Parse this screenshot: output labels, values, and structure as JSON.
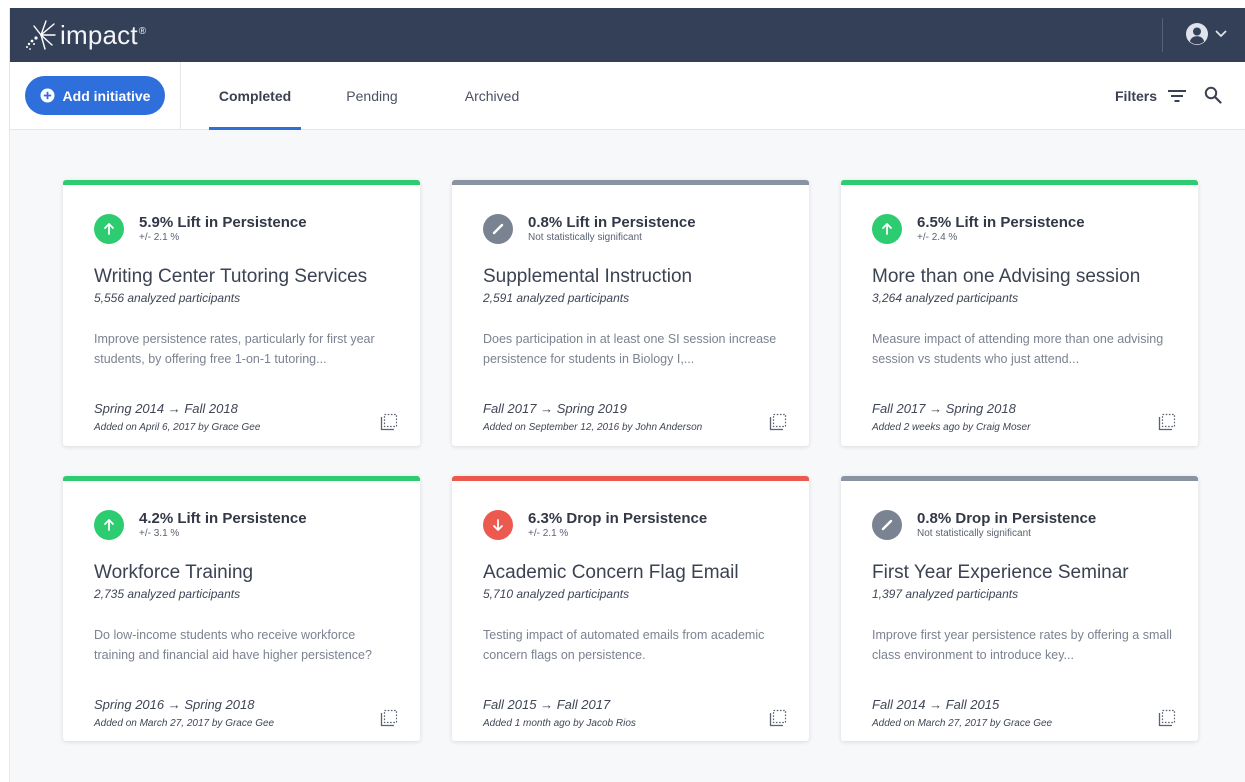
{
  "app": {
    "name": "impact",
    "trademark": "®"
  },
  "colors": {
    "navbar": "#343f58",
    "primary": "#2e6fdb",
    "positive": "#2ecc71",
    "negative": "#ec5a4f",
    "neutral": "#8a93a2"
  },
  "toolbar": {
    "add_label": "Add initiative",
    "tabs": [
      {
        "label": "Completed",
        "active": true
      },
      {
        "label": "Pending",
        "active": false
      },
      {
        "label": "Archived",
        "active": false
      }
    ],
    "filters_label": "Filters"
  },
  "cards": [
    {
      "status": "up",
      "metric": "5.9% Lift in Persistence",
      "metric_sub": "+/- 2.1 %",
      "title": "Writing Center Tutoring Services",
      "participants": "5,556 analyzed participants",
      "description": "Improve persistence rates, particularly for first year students, by offering free 1-on-1 tutoring...",
      "dates": "Spring 2014 → Fall 2018",
      "added": "Added on April 6, 2017 by Grace Gee"
    },
    {
      "status": "ns",
      "metric": "0.8% Lift in Persistence",
      "metric_sub": "Not statistically significant",
      "title": "Supplemental Instruction",
      "participants": "2,591 analyzed participants",
      "description": "Does participation in at least one SI session increase persistence for students in Biology I,...",
      "dates": "Fall 2017 → Spring 2019",
      "added": "Added on September 12,  2016 by John Anderson"
    },
    {
      "status": "up",
      "metric": "6.5% Lift in Persistence",
      "metric_sub": "+/- 2.4 %",
      "title": "More than one Advising session",
      "participants": "3,264 analyzed participants",
      "description": "Measure impact of attending more than one advising session vs students who just attend...",
      "dates": "Fall 2017 → Spring 2018",
      "added": "Added 2 weeks ago by Craig Moser"
    },
    {
      "status": "up",
      "metric": "4.2% Lift in Persistence",
      "metric_sub": "+/- 3.1 %",
      "title": "Workforce Training",
      "participants": "2,735 analyzed participants",
      "description": "Do low-income students who receive workforce training and financial aid have higher persistence?",
      "dates": "Spring 2016 → Spring 2018",
      "added": "Added on March 27, 2017 by Grace Gee"
    },
    {
      "status": "down",
      "metric": "6.3% Drop in Persistence",
      "metric_sub": "+/- 2.1 %",
      "title": "Academic Concern Flag Email",
      "participants": "5,710 analyzed participants",
      "description": "Testing impact of automated emails from academic concern flags on persistence.",
      "dates": "Fall 2015 → Fall 2017",
      "added": "Added 1 month ago by Jacob Rios"
    },
    {
      "status": "ns",
      "metric": "0.8% Drop in Persistence",
      "metric_sub": "Not statistically significant",
      "title": "First Year Experience Seminar",
      "participants": "1,397 analyzed participants",
      "description": "Improve first year persistence rates by offering a small class environment to introduce key...",
      "dates": "Fall 2014 → Fall 2015",
      "added": "Added on March 27, 2017 by Grace Gee"
    }
  ]
}
